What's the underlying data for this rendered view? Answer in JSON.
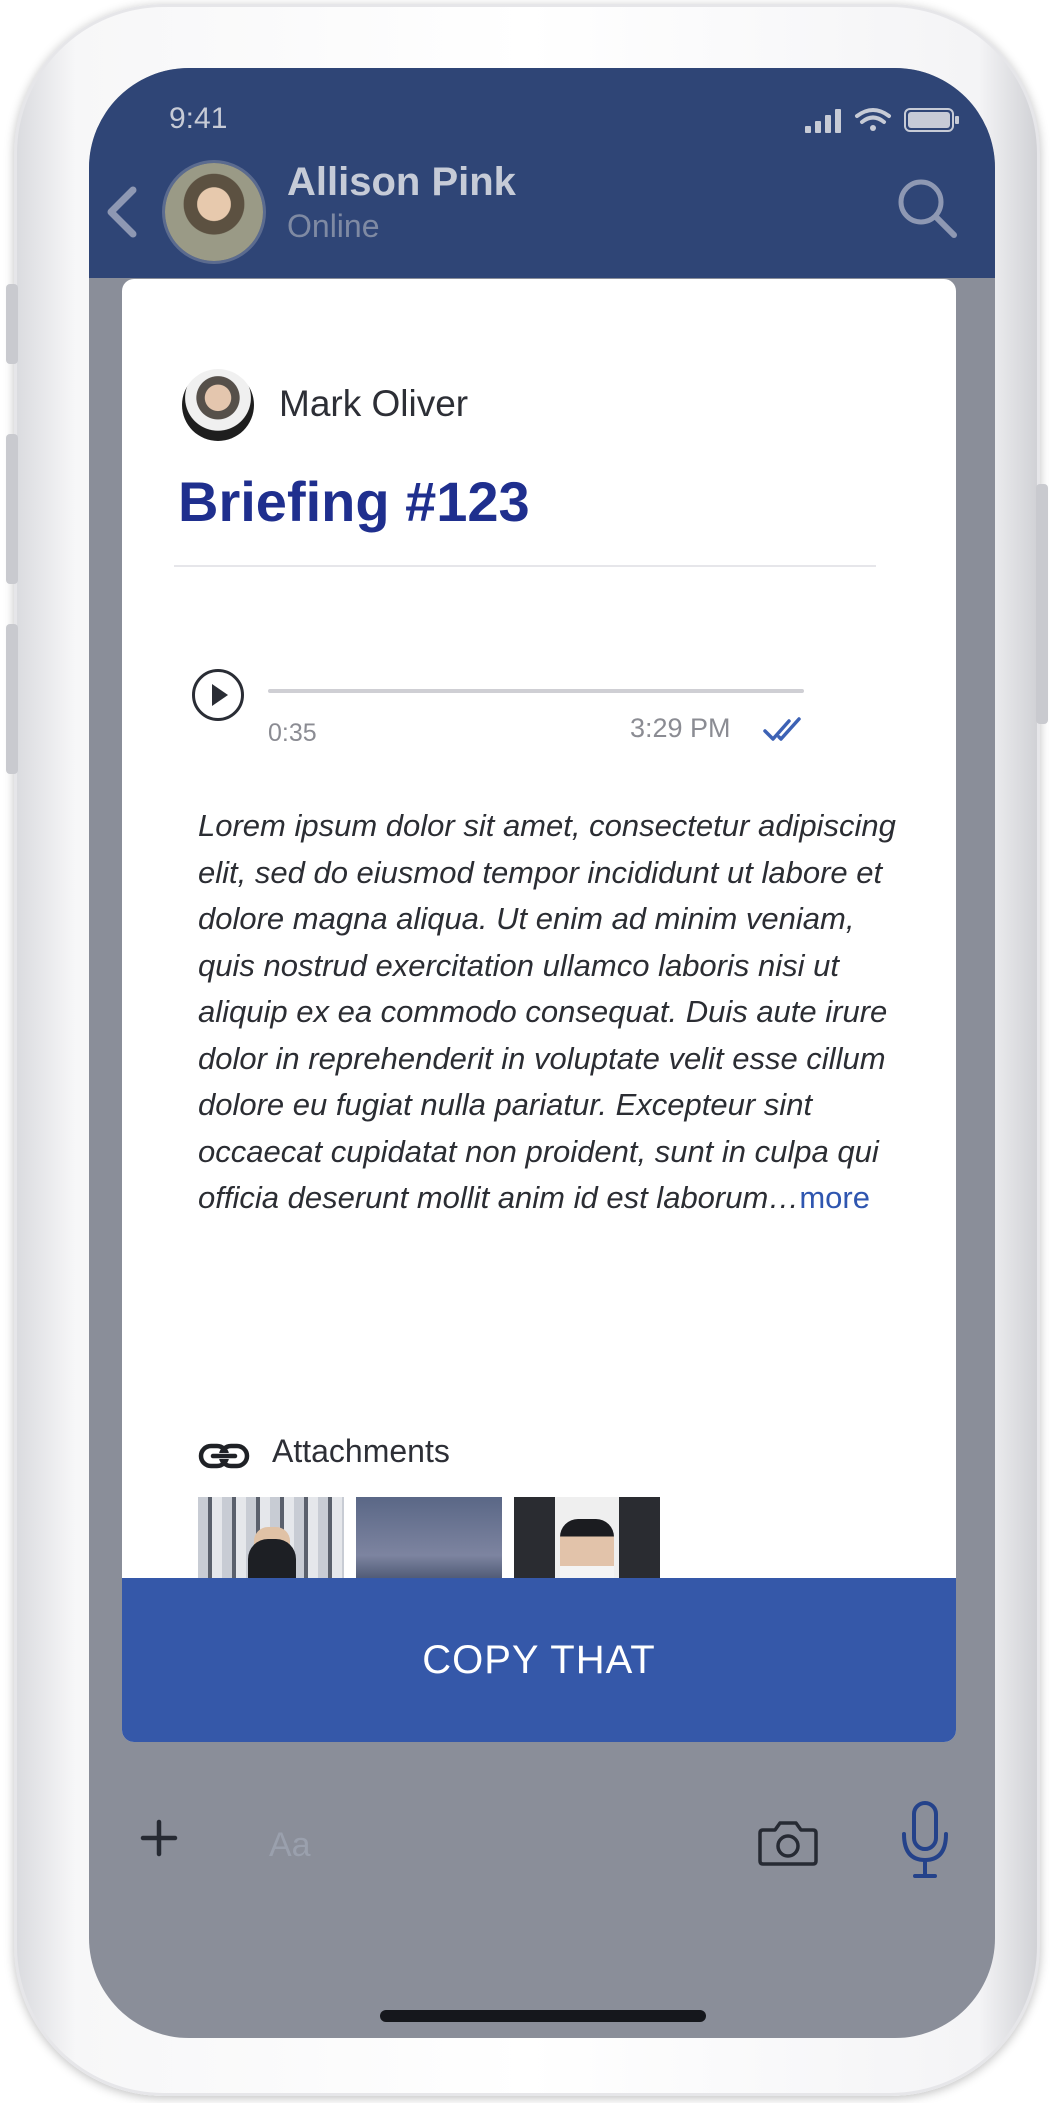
{
  "status_bar": {
    "time": "9:41"
  },
  "header": {
    "contact_name": "Allison Pink",
    "contact_status": "Online"
  },
  "message": {
    "sender_name": "Mark Oliver",
    "title": "Briefing #123",
    "audio": {
      "duration": "0:35",
      "progress": 0
    },
    "sent_time": "3:29 PM",
    "body": "Lorem ipsum dolor sit amet, consectetur adipiscing elit, sed do eiusmod tempor incididunt ut labore et dolore magna aliqua. Ut enim ad minim veniam, quis nostrud exercitation ullamco laboris nisi ut aliquip ex ea commodo consequat. Duis aute irure dolor in reprehenderit in voluptate velit esse cillum dolore eu fugiat nulla pariatur. Excepteur sint occaecat cupidatat non proident, sunt in culpa qui officia deserunt mollit anim id est laborum…",
    "more_label": "more",
    "attachments_label": "Attachments",
    "action_label": "COPY THAT"
  },
  "composer": {
    "placeholder": "Aa"
  },
  "icons": [
    "back-arrow-icon",
    "search-icon",
    "play-icon",
    "double-check-icon",
    "link-icon",
    "plus-icon",
    "camera-icon",
    "microphone-icon"
  ],
  "colors": {
    "header_bg": "#2f4576",
    "title": "#1f2f8e",
    "button_bg": "#3558a9",
    "accent": "#2f56b0",
    "overlay": "#8a8e99"
  }
}
